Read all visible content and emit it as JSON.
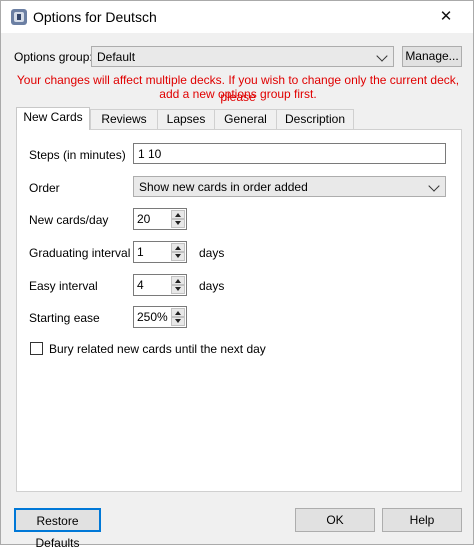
{
  "window": {
    "title": "Options for Deutsch",
    "app_icon": "anki-icon",
    "close_icon": "close-icon"
  },
  "options_group": {
    "label": "Options group:",
    "value": "Default",
    "manage_label": "Manage..."
  },
  "warning": {
    "line1": "Your changes will affect multiple decks. If you wish to change only the current deck, please",
    "line2": "add a new options group first.",
    "color": "#e00000"
  },
  "tabs": [
    {
      "label": "New Cards",
      "active": true
    },
    {
      "label": "Reviews",
      "active": false
    },
    {
      "label": "Lapses",
      "active": false
    },
    {
      "label": "General",
      "active": false
    },
    {
      "label": "Description",
      "active": false
    }
  ],
  "new_cards": {
    "steps": {
      "label": "Steps (in minutes)",
      "value": "1 10"
    },
    "order": {
      "label": "Order",
      "value": "Show new cards in order added"
    },
    "new_per_day": {
      "label": "New cards/day",
      "value": "20"
    },
    "graduating_interval": {
      "label": "Graduating interval",
      "value": "1",
      "unit": "days"
    },
    "easy_interval": {
      "label": "Easy interval",
      "value": "4",
      "unit": "days"
    },
    "starting_ease": {
      "label": "Starting ease",
      "value": "250%"
    },
    "bury": {
      "label": "Bury related new cards until the next day",
      "checked": false
    }
  },
  "footer": {
    "restore_label": "Restore Defaults",
    "ok_label": "OK",
    "help_label": "Help"
  }
}
